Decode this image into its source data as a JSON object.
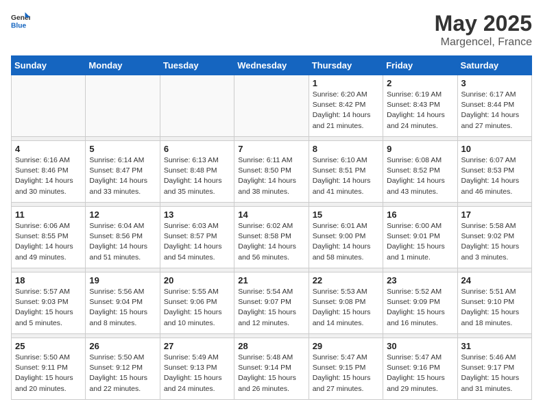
{
  "header": {
    "logo_general": "General",
    "logo_blue": "Blue",
    "month": "May 2025",
    "location": "Margencel, France"
  },
  "weekdays": [
    "Sunday",
    "Monday",
    "Tuesday",
    "Wednesday",
    "Thursday",
    "Friday",
    "Saturday"
  ],
  "weeks": [
    [
      {
        "day": "",
        "sunrise": "",
        "sunset": "",
        "daylight": ""
      },
      {
        "day": "",
        "sunrise": "",
        "sunset": "",
        "daylight": ""
      },
      {
        "day": "",
        "sunrise": "",
        "sunset": "",
        "daylight": ""
      },
      {
        "day": "",
        "sunrise": "",
        "sunset": "",
        "daylight": ""
      },
      {
        "day": "1",
        "sunrise": "Sunrise: 6:20 AM",
        "sunset": "Sunset: 8:42 PM",
        "daylight": "Daylight: 14 hours and 21 minutes."
      },
      {
        "day": "2",
        "sunrise": "Sunrise: 6:19 AM",
        "sunset": "Sunset: 8:43 PM",
        "daylight": "Daylight: 14 hours and 24 minutes."
      },
      {
        "day": "3",
        "sunrise": "Sunrise: 6:17 AM",
        "sunset": "Sunset: 8:44 PM",
        "daylight": "Daylight: 14 hours and 27 minutes."
      }
    ],
    [
      {
        "day": "4",
        "sunrise": "Sunrise: 6:16 AM",
        "sunset": "Sunset: 8:46 PM",
        "daylight": "Daylight: 14 hours and 30 minutes."
      },
      {
        "day": "5",
        "sunrise": "Sunrise: 6:14 AM",
        "sunset": "Sunset: 8:47 PM",
        "daylight": "Daylight: 14 hours and 33 minutes."
      },
      {
        "day": "6",
        "sunrise": "Sunrise: 6:13 AM",
        "sunset": "Sunset: 8:48 PM",
        "daylight": "Daylight: 14 hours and 35 minutes."
      },
      {
        "day": "7",
        "sunrise": "Sunrise: 6:11 AM",
        "sunset": "Sunset: 8:50 PM",
        "daylight": "Daylight: 14 hours and 38 minutes."
      },
      {
        "day": "8",
        "sunrise": "Sunrise: 6:10 AM",
        "sunset": "Sunset: 8:51 PM",
        "daylight": "Daylight: 14 hours and 41 minutes."
      },
      {
        "day": "9",
        "sunrise": "Sunrise: 6:08 AM",
        "sunset": "Sunset: 8:52 PM",
        "daylight": "Daylight: 14 hours and 43 minutes."
      },
      {
        "day": "10",
        "sunrise": "Sunrise: 6:07 AM",
        "sunset": "Sunset: 8:53 PM",
        "daylight": "Daylight: 14 hours and 46 minutes."
      }
    ],
    [
      {
        "day": "11",
        "sunrise": "Sunrise: 6:06 AM",
        "sunset": "Sunset: 8:55 PM",
        "daylight": "Daylight: 14 hours and 49 minutes."
      },
      {
        "day": "12",
        "sunrise": "Sunrise: 6:04 AM",
        "sunset": "Sunset: 8:56 PM",
        "daylight": "Daylight: 14 hours and 51 minutes."
      },
      {
        "day": "13",
        "sunrise": "Sunrise: 6:03 AM",
        "sunset": "Sunset: 8:57 PM",
        "daylight": "Daylight: 14 hours and 54 minutes."
      },
      {
        "day": "14",
        "sunrise": "Sunrise: 6:02 AM",
        "sunset": "Sunset: 8:58 PM",
        "daylight": "Daylight: 14 hours and 56 minutes."
      },
      {
        "day": "15",
        "sunrise": "Sunrise: 6:01 AM",
        "sunset": "Sunset: 9:00 PM",
        "daylight": "Daylight: 14 hours and 58 minutes."
      },
      {
        "day": "16",
        "sunrise": "Sunrise: 6:00 AM",
        "sunset": "Sunset: 9:01 PM",
        "daylight": "Daylight: 15 hours and 1 minute."
      },
      {
        "day": "17",
        "sunrise": "Sunrise: 5:58 AM",
        "sunset": "Sunset: 9:02 PM",
        "daylight": "Daylight: 15 hours and 3 minutes."
      }
    ],
    [
      {
        "day": "18",
        "sunrise": "Sunrise: 5:57 AM",
        "sunset": "Sunset: 9:03 PM",
        "daylight": "Daylight: 15 hours and 5 minutes."
      },
      {
        "day": "19",
        "sunrise": "Sunrise: 5:56 AM",
        "sunset": "Sunset: 9:04 PM",
        "daylight": "Daylight: 15 hours and 8 minutes."
      },
      {
        "day": "20",
        "sunrise": "Sunrise: 5:55 AM",
        "sunset": "Sunset: 9:06 PM",
        "daylight": "Daylight: 15 hours and 10 minutes."
      },
      {
        "day": "21",
        "sunrise": "Sunrise: 5:54 AM",
        "sunset": "Sunset: 9:07 PM",
        "daylight": "Daylight: 15 hours and 12 minutes."
      },
      {
        "day": "22",
        "sunrise": "Sunrise: 5:53 AM",
        "sunset": "Sunset: 9:08 PM",
        "daylight": "Daylight: 15 hours and 14 minutes."
      },
      {
        "day": "23",
        "sunrise": "Sunrise: 5:52 AM",
        "sunset": "Sunset: 9:09 PM",
        "daylight": "Daylight: 15 hours and 16 minutes."
      },
      {
        "day": "24",
        "sunrise": "Sunrise: 5:51 AM",
        "sunset": "Sunset: 9:10 PM",
        "daylight": "Daylight: 15 hours and 18 minutes."
      }
    ],
    [
      {
        "day": "25",
        "sunrise": "Sunrise: 5:50 AM",
        "sunset": "Sunset: 9:11 PM",
        "daylight": "Daylight: 15 hours and 20 minutes."
      },
      {
        "day": "26",
        "sunrise": "Sunrise: 5:50 AM",
        "sunset": "Sunset: 9:12 PM",
        "daylight": "Daylight: 15 hours and 22 minutes."
      },
      {
        "day": "27",
        "sunrise": "Sunrise: 5:49 AM",
        "sunset": "Sunset: 9:13 PM",
        "daylight": "Daylight: 15 hours and 24 minutes."
      },
      {
        "day": "28",
        "sunrise": "Sunrise: 5:48 AM",
        "sunset": "Sunset: 9:14 PM",
        "daylight": "Daylight: 15 hours and 26 minutes."
      },
      {
        "day": "29",
        "sunrise": "Sunrise: 5:47 AM",
        "sunset": "Sunset: 9:15 PM",
        "daylight": "Daylight: 15 hours and 27 minutes."
      },
      {
        "day": "30",
        "sunrise": "Sunrise: 5:47 AM",
        "sunset": "Sunset: 9:16 PM",
        "daylight": "Daylight: 15 hours and 29 minutes."
      },
      {
        "day": "31",
        "sunrise": "Sunrise: 5:46 AM",
        "sunset": "Sunset: 9:17 PM",
        "daylight": "Daylight: 15 hours and 31 minutes."
      }
    ]
  ]
}
